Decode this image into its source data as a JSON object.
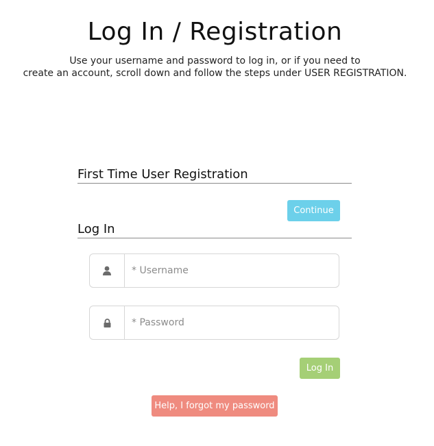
{
  "page": {
    "title": "Log In / Registration",
    "intro_line1": "Use your username and password to log in, or if you need to",
    "intro_line2": "create an account, scroll down and follow the steps under USER REGISTRATION."
  },
  "registration": {
    "heading": "First Time User Registration",
    "continue_label": "Continue"
  },
  "login": {
    "heading": "Log In",
    "username_placeholder": "* Username",
    "password_placeholder": "* Password",
    "username_icon": "user-icon",
    "password_icon": "lock-icon",
    "login_label": "Log In",
    "forgot_label": "Help, I forgot my password"
  },
  "colors": {
    "continue": "#6cd0ea",
    "login": "#a5cf76",
    "forgot": "#ef8b7f"
  }
}
